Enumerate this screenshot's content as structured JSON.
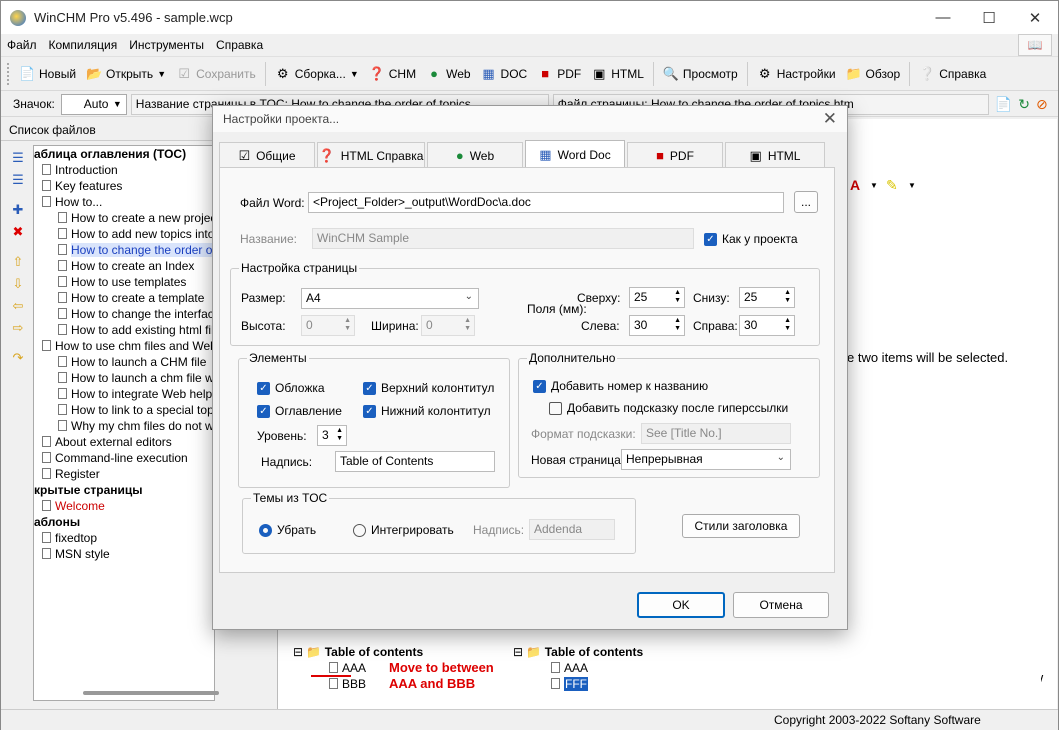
{
  "window": {
    "title": "WinCHM Pro v5.496 - sample.wcp"
  },
  "menu": [
    "Файл",
    "Компиляция",
    "Инструменты",
    "Справка"
  ],
  "toolbar": {
    "new": "Новый",
    "open": "Открыть",
    "save": "Сохранить",
    "build": "Сборка...",
    "chm": "CHM",
    "web": "Web",
    "doc": "DOC",
    "pdf": "PDF",
    "html": "HTML",
    "preview": "Просмотр",
    "settings": "Настройки",
    "browse": "Обзор",
    "help": "Справка"
  },
  "row2": {
    "icon_label": "Значок:",
    "icon_value": "Auto",
    "toc_name": "Название страницы в TOC: How to change the order of topics",
    "file_name": "Файл страницы: How to change the order of topics.htm"
  },
  "left_panel": {
    "title": "Список файлов",
    "tree": [
      {
        "text": "аблица оглавления (TOC)",
        "bold": true
      },
      {
        "text": "Introduction"
      },
      {
        "text": "Key features"
      },
      {
        "text": "How to..."
      },
      {
        "text": "How to create a new project"
      },
      {
        "text": "How to add new topics into Tab"
      },
      {
        "text": "How to change the order of topic",
        "selected": true
      },
      {
        "text": "How to create an Index"
      },
      {
        "text": "How to use templates"
      },
      {
        "text": "How to create a template"
      },
      {
        "text": "How to change the interface of t"
      },
      {
        "text": "How to add existing html files to"
      },
      {
        "text": "How to use chm files and Web Help"
      },
      {
        "text": "How to launch a CHM file"
      },
      {
        "text": "How to launch a chm file with a"
      },
      {
        "text": "How to integrate Web help into y"
      },
      {
        "text": "How to link to a special topic in T"
      },
      {
        "text": "Why my chm files do not work"
      },
      {
        "text": "About external editors"
      },
      {
        "text": "Command-line execution"
      },
      {
        "text": "Register"
      },
      {
        "text": "крытые страницы",
        "bold": true
      },
      {
        "text": "Welcome",
        "red": true
      },
      {
        "text": "аблоны",
        "bold": true
      },
      {
        "text": "fixedtop"
      },
      {
        "text": "MSN style"
      }
    ]
  },
  "editor": {
    "visible_text": "e two items will be selected."
  },
  "lower_pane": {
    "toc_left": "Table of contents",
    "items_left": [
      "AAA",
      "BBB"
    ],
    "move_hint_1": "Move to between",
    "move_hint_2": "AAA and BBB",
    "toc_right": "Table of contents",
    "items_right": [
      "AAA",
      "FFF"
    ]
  },
  "status": {
    "copyright": "Copyright 2003-2022 Softany Software"
  },
  "dialog": {
    "title": "Настройки проекта...",
    "tabs": [
      "Общие",
      "HTML Справка",
      "Web",
      "Word Doc",
      "PDF",
      "HTML"
    ],
    "word_file_label": "Файл Word:",
    "word_file_value": "<Project_Folder>_output\\WordDoc\\a.doc",
    "browse_btn": "...",
    "name_label": "Название:",
    "name_value": "WinCHM Sample",
    "as_project": "Как у проекта",
    "page_setup": {
      "title": "Настройка страницы",
      "size_label": "Размер:",
      "size_value": "A4",
      "height_label": "Высота:",
      "height_value": "0",
      "width_label": "Ширина:",
      "width_value": "0",
      "margins_label": "Поля (мм):",
      "top_label": "Сверху:",
      "top_value": "25",
      "bottom_label": "Снизу:",
      "bottom_value": "25",
      "left_label": "Слева:",
      "left_value": "30",
      "right_label": "Справа:",
      "right_value": "30"
    },
    "elements": {
      "title": "Элементы",
      "cover": "Обложка",
      "header": "Верхний колонтитул",
      "toc": "Оглавление",
      "footer": "Нижний колонтитул",
      "level_label": "Уровень:",
      "level_value": "3",
      "caption_label": "Надпись:",
      "caption_value": "Table of Contents"
    },
    "extra": {
      "title": "Дополнительно",
      "add_number": "Добавить номер к названию",
      "add_hint": "Добавить подсказку после гиперссылки",
      "hint_format_label": "Формат подсказки:",
      "hint_format_value": "See [Title No.]",
      "new_page_label": "Новая страница:",
      "new_page_value": "Непрерывная"
    },
    "toc_topics": {
      "title": "Темы из TOC",
      "remove": "Убрать",
      "integrate": "Интегрировать",
      "caption_label": "Надпись:",
      "caption_value": "Addenda"
    },
    "heading_styles_btn": "Стили заголовка",
    "ok": "OK",
    "cancel": "Отмена"
  }
}
